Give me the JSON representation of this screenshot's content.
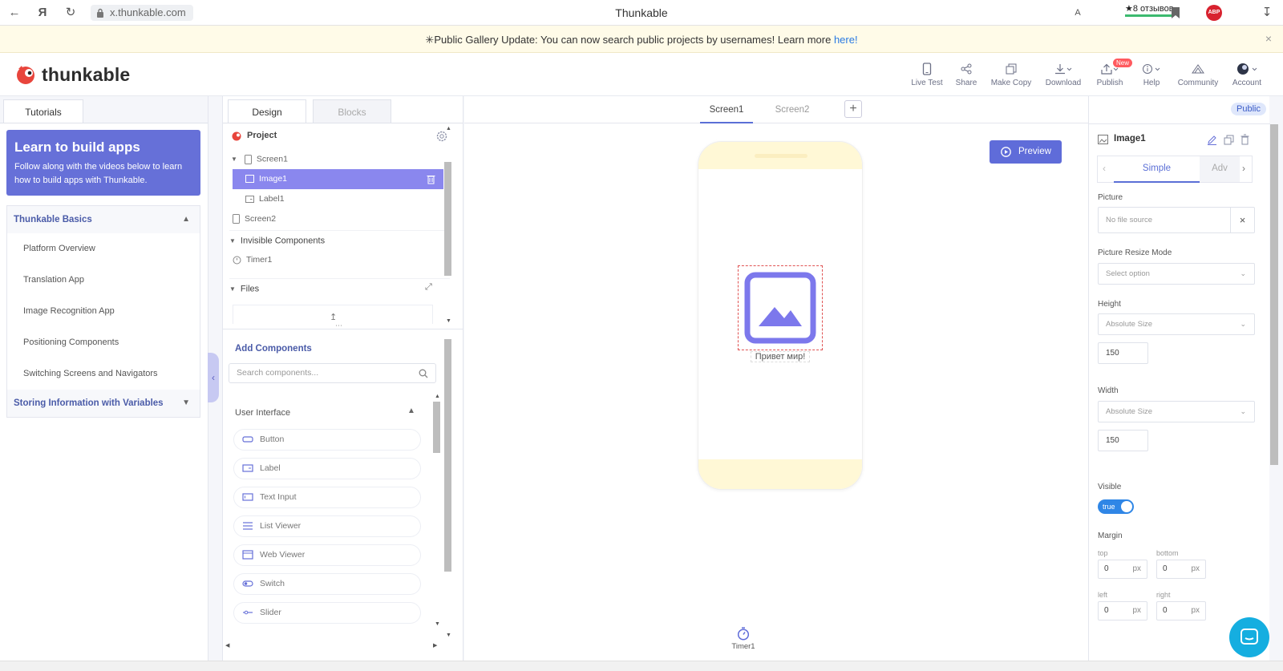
{
  "browser": {
    "url": "x.thunkable.com",
    "title": "Thunkable",
    "reviews": "★8 отзывов",
    "yandex_glyph": "Я",
    "translate_glyph": "A",
    "abp": "ABP"
  },
  "banner": {
    "text": "Public Gallery Update: You can now search public projects by usernames! Learn more ",
    "link": "here!",
    "close": "×"
  },
  "header": {
    "logo": "thunkable",
    "nav": [
      {
        "label": "Live Test",
        "icon": "phone-icon"
      },
      {
        "label": "Share",
        "icon": "share-icon"
      },
      {
        "label": "Make Copy",
        "icon": "copy-icon"
      },
      {
        "label": "Download",
        "icon": "download-icon"
      },
      {
        "label": "Publish",
        "icon": "publish-icon",
        "badge": "New"
      },
      {
        "label": "Help",
        "icon": "help-icon"
      },
      {
        "label": "Community",
        "icon": "community-icon"
      },
      {
        "label": "Account",
        "icon": "avatar-icon"
      }
    ]
  },
  "tutorials": {
    "tab": "Tutorials",
    "card_title": "Learn to build apps",
    "card_text": "Follow along with the videos below to learn how to build apps with Thunkable.",
    "section1": "Thunkable Basics",
    "items": [
      "Platform Overview",
      "Translation App",
      "Image Recognition App",
      "Positioning Components",
      "Switching Screens and Navigators"
    ],
    "section2": "Storing Information with Variables"
  },
  "editor": {
    "tabs": [
      "Design",
      "Blocks"
    ],
    "project_label": "Project",
    "tree": {
      "screen1": "Screen1",
      "image1": "Image1",
      "label1": "Label1",
      "screen2": "Screen2",
      "invisible": "Invisible Components",
      "timer1": "Timer1",
      "files": "Files"
    },
    "add_components": "Add Components",
    "search_placeholder": "Search components...",
    "ui_section": "User Interface",
    "components": [
      "Button",
      "Label",
      "Text Input",
      "List Viewer",
      "Web Viewer",
      "Switch",
      "Slider"
    ]
  },
  "canvas": {
    "screen_tabs": [
      "Screen1",
      "Screen2"
    ],
    "add_screen": "+",
    "preview": "Preview",
    "label_text": "Привет мир!",
    "timer_label": "Timer1"
  },
  "properties": {
    "public": "Public",
    "title": "Image1",
    "tabs": [
      "Simple",
      "Adv"
    ],
    "picture_label": "Picture",
    "picture_value": "No file source",
    "resize_label": "Picture Resize Mode",
    "resize_value": "Select option",
    "height_label": "Height",
    "height_mode": "Absolute Size",
    "height_value": "150",
    "width_label": "Width",
    "width_mode": "Absolute Size",
    "width_value": "150",
    "visible_label": "Visible",
    "visible_value": "true",
    "margin_label": "Margin",
    "margin": {
      "top": "0",
      "bottom": "0",
      "left": "0",
      "right": "0",
      "unit": "px"
    },
    "margin_names": {
      "top": "top",
      "bottom": "bottom",
      "left": "left",
      "right": "right"
    }
  },
  "colors": {
    "accent": "#5f6cd9",
    "selected_row": "#8a87ee",
    "phone_bar": "#fff8d6",
    "toggle": "#2f86e6",
    "chat": "#15aee0"
  }
}
